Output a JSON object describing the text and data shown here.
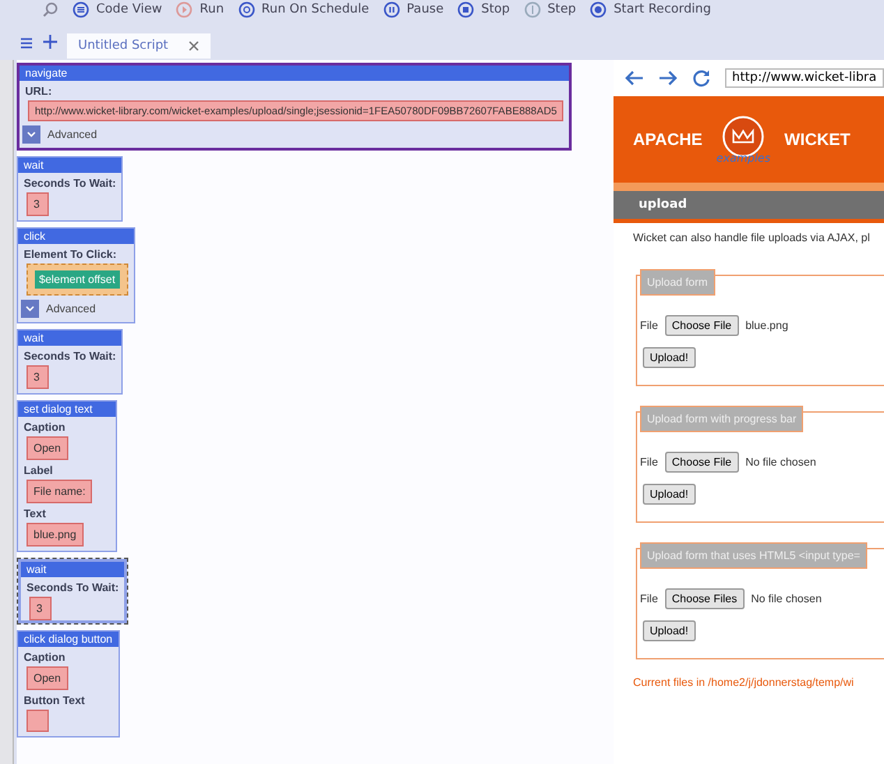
{
  "toolbar": [
    {
      "label": "Code View"
    },
    {
      "label": "Run"
    },
    {
      "label": "Run On Schedule"
    },
    {
      "label": "Pause"
    },
    {
      "label": "Stop"
    },
    {
      "label": "Step"
    },
    {
      "label": "Start Recording"
    }
  ],
  "tabs": [
    {
      "label": "Untitled Script",
      "selected": true
    }
  ],
  "commands": [
    {
      "title": "navigate",
      "selected": true,
      "focused": false,
      "fields": [
        {
          "kind": "text",
          "label": "URL:",
          "value": "http://www.wicket-library.com/wicket-examples/upload/single;jsessionid=1FEA50780DF09BB72607FABE888AD5"
        }
      ],
      "advanced": "Advanced"
    },
    {
      "title": "wait",
      "selected": false,
      "focused": false,
      "fields": [
        {
          "kind": "text",
          "label": "Seconds To Wait:",
          "value": "3"
        }
      ]
    },
    {
      "title": "click",
      "selected": false,
      "focused": false,
      "fields": [
        {
          "kind": "element",
          "label": "Element To Click:",
          "value": "$element offset"
        }
      ],
      "advanced": "Advanced"
    },
    {
      "title": "wait",
      "selected": false,
      "focused": false,
      "fields": [
        {
          "kind": "text",
          "label": "Seconds To Wait:",
          "value": "3"
        }
      ]
    },
    {
      "title": "set dialog text",
      "selected": false,
      "focused": false,
      "fields": [
        {
          "kind": "text",
          "label": "Caption",
          "value": "Open"
        },
        {
          "kind": "text",
          "label": "Label",
          "value": "File name:"
        },
        {
          "kind": "text",
          "label": "Text",
          "value": "blue.png"
        }
      ]
    },
    {
      "title": "wait",
      "selected": false,
      "focused": true,
      "fields": [
        {
          "kind": "text",
          "label": "Seconds To Wait:",
          "value": "3"
        }
      ]
    },
    {
      "title": "click dialog button",
      "selected": false,
      "focused": false,
      "fields": [
        {
          "kind": "text",
          "label": "Caption",
          "value": "Open"
        },
        {
          "kind": "text",
          "label": "Button Text"
        }
      ]
    }
  ],
  "browser": {
    "url": "http://www.wicket-libra",
    "logo_left": "APACHE",
    "logo_right": "WICKET",
    "logo_sub": "examples",
    "section": "upload",
    "intro": "Wicket can also handle file uploads via AJAX, pl",
    "forms": [
      {
        "legend": "Upload form",
        "file_label": "File",
        "choose_button": "Choose File",
        "file_status": "blue.png",
        "upload_button": "Upload!"
      },
      {
        "legend": "Upload form with progress bar",
        "file_label": "File",
        "choose_button": "Choose File",
        "file_status": "No file chosen",
        "upload_button": "Upload!"
      },
      {
        "legend": "Upload form that uses HTML5 <input type=",
        "file_label": "File",
        "choose_button": "Choose Files",
        "file_status": "No file chosen",
        "upload_button": "Upload!"
      }
    ],
    "footer": "Current files in /home2/j/jdonnerstag/temp/wi"
  }
}
